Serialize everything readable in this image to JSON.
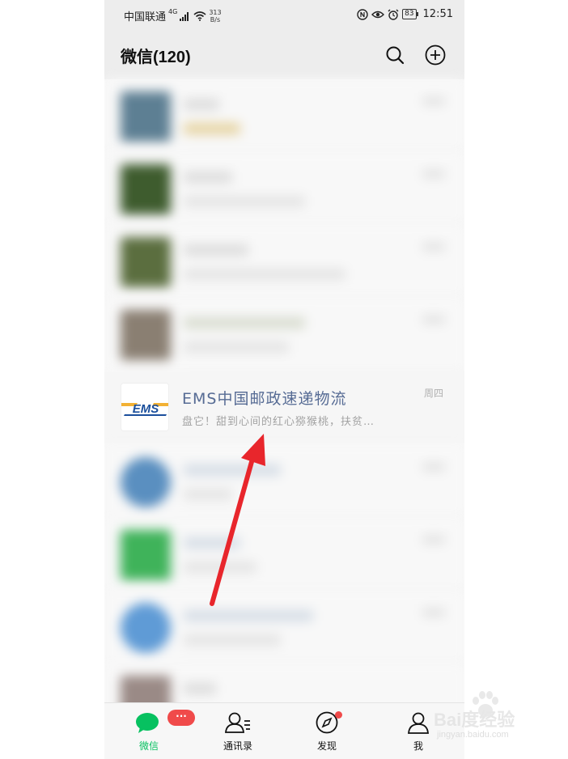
{
  "status_bar": {
    "carrier": "中国联通",
    "signal_type": "4G",
    "net_speed_value": "313",
    "net_speed_unit": "B/s",
    "battery": "83",
    "time": "12:51"
  },
  "header": {
    "title": "微信(120)"
  },
  "icons": {
    "search": "search-icon",
    "add": "plus-circle-icon",
    "chats_tab": "chat-bubble-icon",
    "contacts_tab": "contacts-icon",
    "discover_tab": "compass-icon",
    "me_tab": "person-icon"
  },
  "chats": {
    "highlighted": {
      "name": "EMS中国邮政速递物流",
      "preview": "盘它！甜到心间的红心猕猴桃，扶贫…",
      "time": "周四",
      "logo_text": "EMS"
    }
  },
  "tabbar": {
    "tabs": [
      {
        "label": "微信",
        "badge": "···"
      },
      {
        "label": "通讯录"
      },
      {
        "label": "发现"
      },
      {
        "label": "我"
      }
    ]
  },
  "watermark": {
    "brand": "Bai度经验",
    "url": "jingyan.baidu.com"
  },
  "colors": {
    "accent_green": "#07c160",
    "badge_red": "#f04a4a",
    "arrow_red": "#e8262c",
    "name_blue": "#566b94"
  }
}
